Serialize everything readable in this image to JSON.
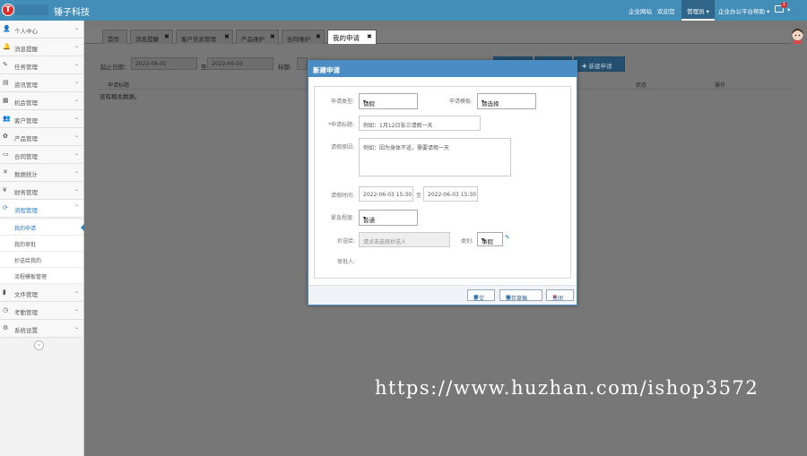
{
  "header": {
    "logo_letter": "T",
    "brand": "锤子科技",
    "links": [
      "企业网站",
      "欢迎您"
    ],
    "active_user": "管理员 ▾",
    "help": "企业办公平台帮助 ▾",
    "mail_badge": "1"
  },
  "sidebar": {
    "items": [
      {
        "icon": "👤",
        "label": "个人中心"
      },
      {
        "icon": "🔔",
        "label": "消息提醒"
      },
      {
        "icon": "✎",
        "label": "任务管理"
      },
      {
        "icon": "▤",
        "label": "资讯管理"
      },
      {
        "icon": "▦",
        "label": "机会管理"
      },
      {
        "icon": "👥",
        "label": "客户管理"
      },
      {
        "icon": "✿",
        "label": "产品管理"
      },
      {
        "icon": "▭",
        "label": "合同管理"
      },
      {
        "icon": "✕",
        "label": "数据统计"
      },
      {
        "icon": "¥",
        "label": "财务管理"
      },
      {
        "icon": "⟳",
        "label": "流程管理"
      }
    ],
    "sub_items": [
      "我的申请",
      "我的审批",
      "抄送给我的",
      "流程模板管理"
    ],
    "bottom_items": [
      {
        "icon": "▮",
        "label": "文件管理"
      },
      {
        "icon": "◷",
        "label": "考勤管理"
      },
      {
        "icon": "⚙",
        "label": "系统设置"
      }
    ],
    "collapse_icon": "«"
  },
  "tabs": [
    {
      "label": "首页"
    },
    {
      "label": "消息提醒"
    },
    {
      "label": "客户信息管理"
    },
    {
      "label": "产品维护"
    },
    {
      "label": "合同维护"
    },
    {
      "label": "我的申请"
    }
  ],
  "filters": {
    "start_label": "起止日期：",
    "start_date": "2022-06-01",
    "to_label": "至",
    "end_date": "2022-06-03",
    "title_label": "标题:",
    "add_button": "✚ 新建申请"
  },
  "table": {
    "headers": [
      "申请标题",
      "状态",
      "操作"
    ],
    "empty": "没有相关数据。"
  },
  "modal": {
    "title": "新建申请",
    "close": "×",
    "type_label": "申请类型:",
    "type_value": "请假",
    "template_label": "申请模板:",
    "template_value": "请选择",
    "title_label": "*申请标题:",
    "title_placeholder": "例如：1月12日张三请假一天",
    "reason_label": "请假原因:",
    "reason_placeholder": "例如：因为身体不适，需要请假一天",
    "time_label": "请假时间:",
    "time_start": "2022-06-03 15:30",
    "time_sep": "至",
    "time_end": "2022-06-03 15:30",
    "urgency_label": "紧急程度:",
    "urgency_value": "普通",
    "cc_label": "抄送给:",
    "cc_placeholder": "请点击选择抄送人",
    "category_label": "类别:",
    "category_value": "事假",
    "approver_label": "审批人:",
    "btn_submit": "提交",
    "btn_draft": "保存草稿",
    "btn_close": "关闭"
  },
  "watermark": "https://www.huzhan.com/ishop3572",
  "colors": {
    "topbar": "#438eb9",
    "modal_header": "#4a8cc4",
    "overlay": "#777777"
  }
}
